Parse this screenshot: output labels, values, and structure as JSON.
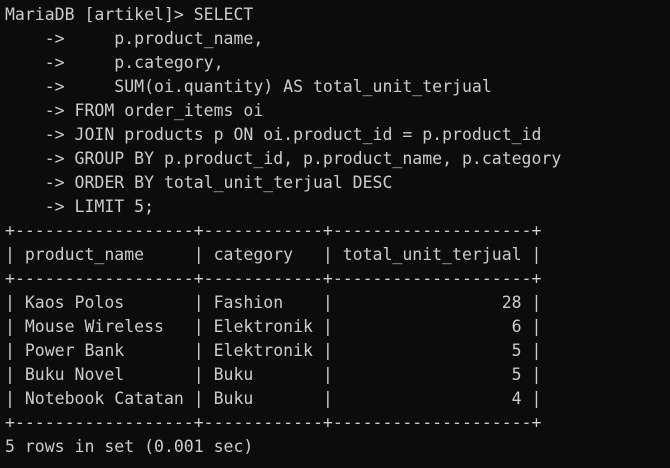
{
  "terminal": {
    "foreground": "#cccccc",
    "background": "#0c0c0c",
    "lines": [
      "MariaDB [artikel]> SELECT",
      "    ->     p.product_name,",
      "    ->     p.category,",
      "    ->     SUM(oi.quantity) AS total_unit_terjual",
      "    -> FROM order_items oi",
      "    -> JOIN products p ON oi.product_id = p.product_id",
      "    -> GROUP BY p.product_id, p.product_name, p.category",
      "    -> ORDER BY total_unit_terjual DESC",
      "    -> LIMIT 5;",
      "+------------------+------------+--------------------+",
      "| product_name     | category   | total_unit_terjual |",
      "+------------------+------------+--------------------+",
      "| Kaos Polos       | Fashion    |                 28 |",
      "| Mouse Wireless   | Elektronik |                  6 |",
      "| Power Bank       | Elektronik |                  5 |",
      "| Buku Novel       | Buku       |                  5 |",
      "| Notebook Catatan | Buku       |                  4 |",
      "+------------------+------------+--------------------+",
      "5 rows in set (0.001 sec)"
    ]
  }
}
